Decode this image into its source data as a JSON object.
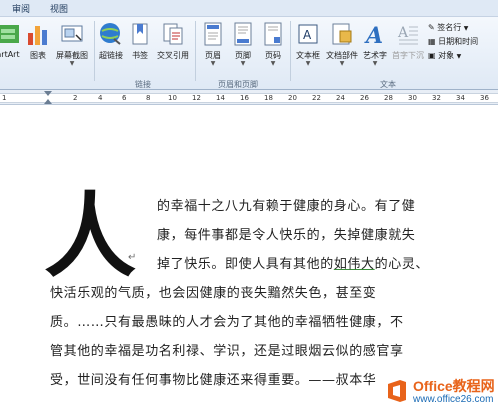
{
  "tabs": [
    "审阅",
    "视图"
  ],
  "ribbon": {
    "buttons": {
      "smartart": "artArt",
      "chart": "图表",
      "screenshot": "屏幕截图",
      "hyperlink": "超链接",
      "bookmark": "书签",
      "crossref": "交叉引用",
      "header": "页眉",
      "footer": "页脚",
      "pagenum": "页码",
      "textbox": "文本框",
      "quickparts": "文档部件",
      "wordart": "艺术字",
      "dropcap": "首字下沉",
      "signature": "签名行",
      "datetime": "日期和时间",
      "object": "对象"
    },
    "groups": {
      "links": "链接",
      "header_footer": "页眉和页脚",
      "text": "文本"
    }
  },
  "ruler": {
    "numbers": [
      "1",
      "2",
      "4",
      "6",
      "8",
      "10",
      "12",
      "14",
      "16",
      "18",
      "20",
      "22",
      "24",
      "26",
      "28",
      "30",
      "32",
      "34",
      "36"
    ]
  },
  "document": {
    "dropcap": "人",
    "lines": [
      "的幸福十之八九有赖于健康的身心。有了健",
      "康，每件事都是令人快乐的，失掉健康就失",
      "掉了快乐。即使人具有其他的",
      "如伟大",
      "的心灵、",
      "快活乐观的气质，也会因健康的丧失黯然失色，甚至变",
      "质。……只有最愚昧的人才会为了其他的幸福牺牲健康，不",
      "管其他的幸福是功名利禄、学识，还是过眼烟云似的感官享",
      "受，世间没有任何事物比健康还来得重要。——叔本华"
    ],
    "paragraph_mark": "↵"
  },
  "watermark": {
    "site": "Office教程网",
    "url": "www.office26.com"
  }
}
